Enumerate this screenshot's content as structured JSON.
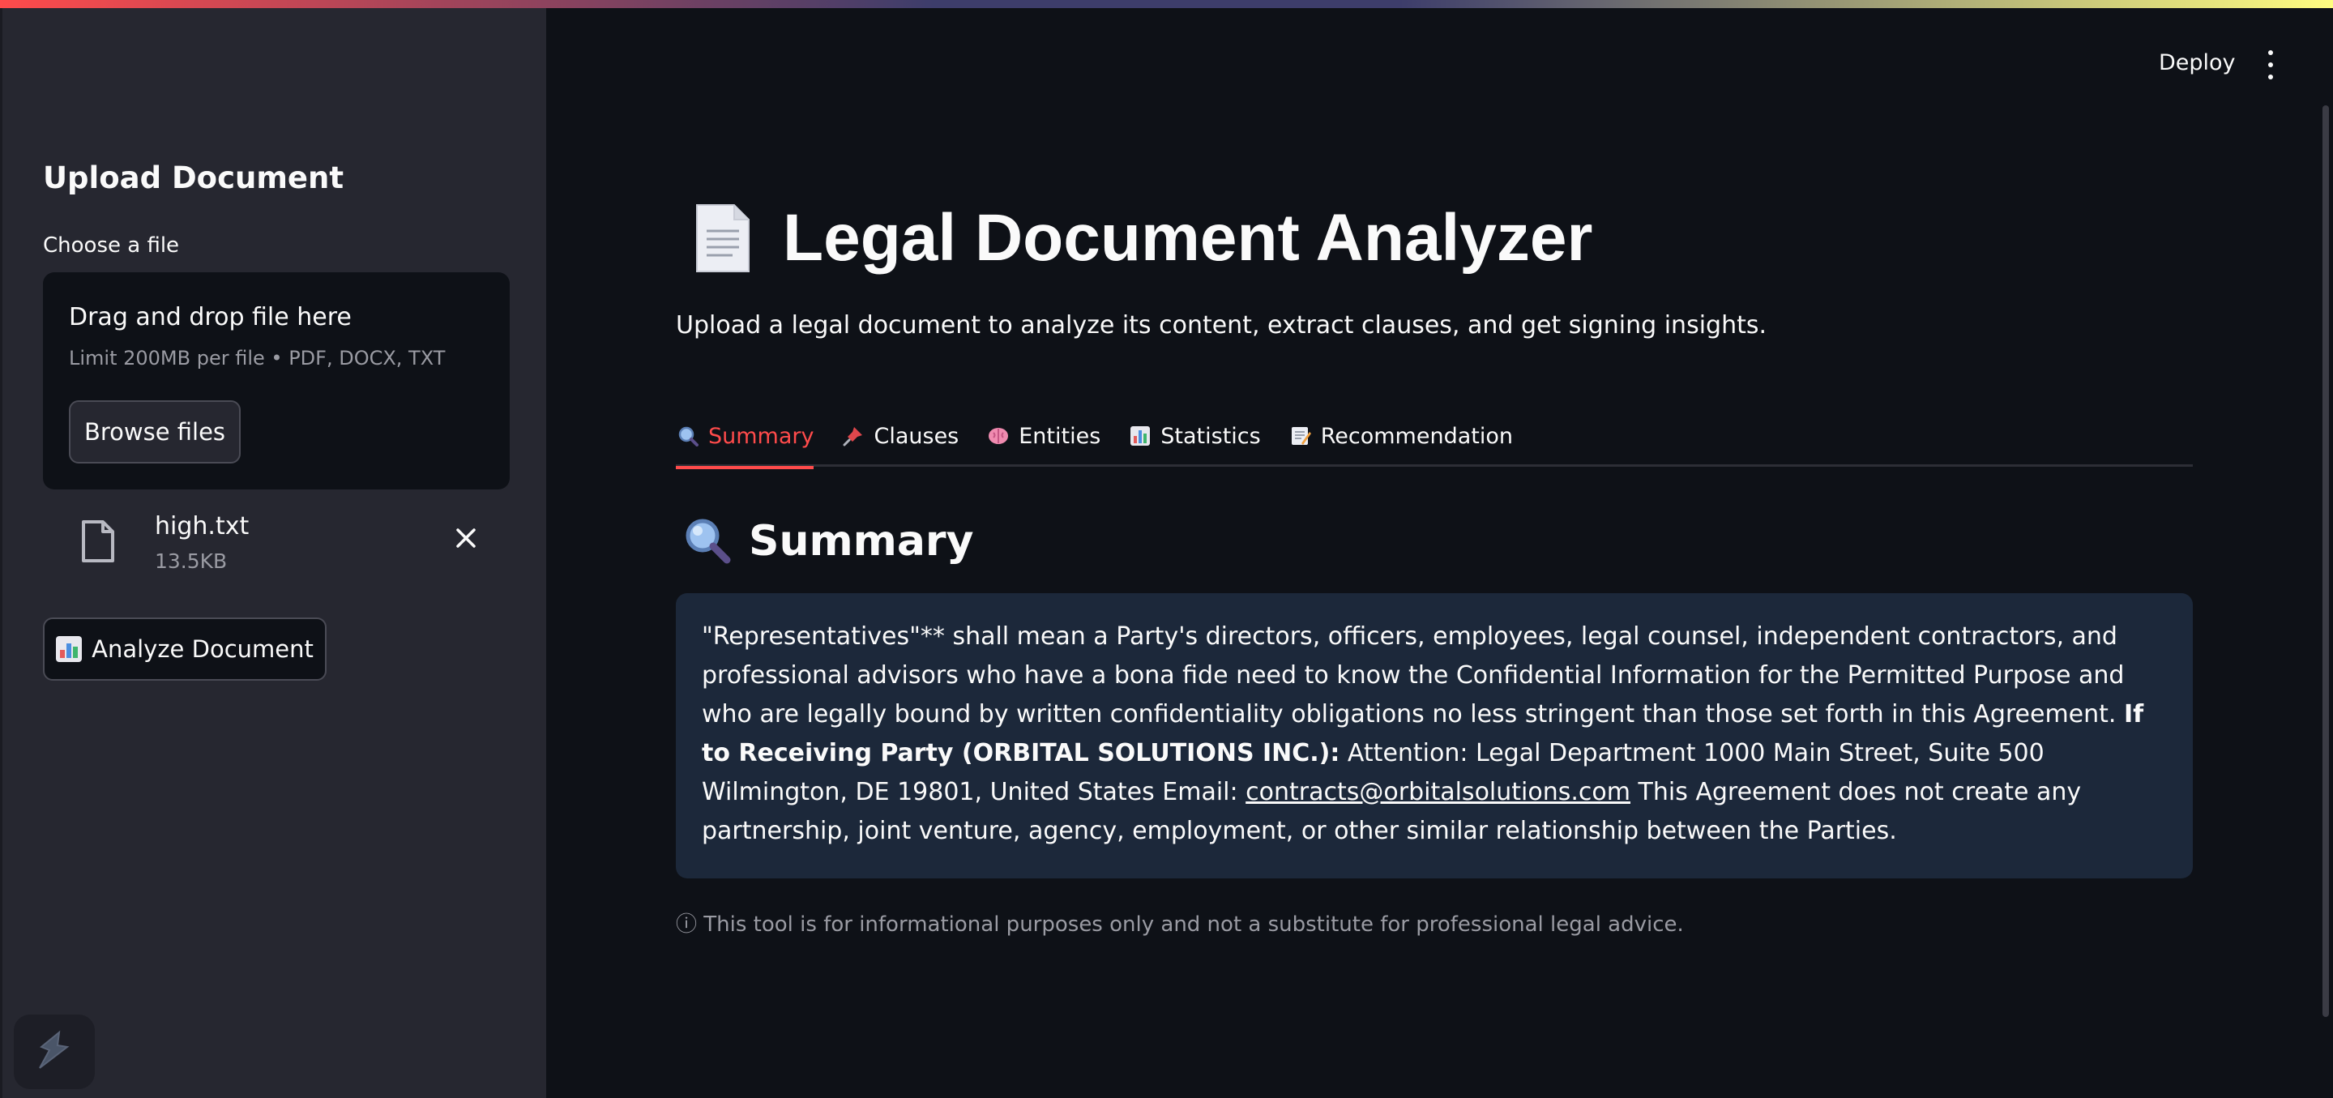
{
  "sidebar": {
    "title": "Upload Document",
    "uploader_label": "Choose a file",
    "dropzone_title": "Drag and drop file here",
    "dropzone_limit": "Limit 200MB per file • PDF, DOCX, TXT",
    "browse_label": "Browse files",
    "file": {
      "name": "high.txt",
      "size": "13.5KB"
    },
    "analyze_label": "Analyze Document"
  },
  "header": {
    "deploy_label": "Deploy"
  },
  "main": {
    "title": "Legal Document Analyzer",
    "subtitle": "Upload a legal document to analyze its content, extract clauses, and get signing insights.",
    "tabs": [
      {
        "label": "Summary",
        "icon": "magnifier-icon"
      },
      {
        "label": "Clauses",
        "icon": "pushpin-icon"
      },
      {
        "label": "Entities",
        "icon": "brain-icon"
      },
      {
        "label": "Statistics",
        "icon": "bar-chart-icon"
      },
      {
        "label": "Recommendation",
        "icon": "memo-icon"
      }
    ],
    "active_tab": "Summary",
    "section_title": "Summary",
    "summary": {
      "part1": "\"Representatives\"** shall mean a Party's directors, officers, employees, legal counsel, independent contractors, and professional advisors who have a bona fide need to know the Confidential Information for the Permitted Purpose and who are legally bound by written confidentiality obligations no less stringent than those set forth in this Agreement. ",
      "bold": "If to Receiving Party (ORBITAL SOLUTIONS INC.):",
      "part2": " Attention: Legal Department 1000 Main Street, Suite 500 Wilmington, DE 19801, United States Email: ",
      "email": "contracts@orbitalsolutions.com",
      "part3": " This Agreement does not create any partnership, joint venture, agency, employment, or other similar relationship between the Parties."
    },
    "disclaimer": "ⓘ This tool is for informational purposes only and not a substitute for professional legal advice."
  },
  "colors": {
    "accent": "#ff4b4b",
    "sidebar_bg": "#262730",
    "main_bg": "#0e1117",
    "summary_bg": "#1c283a"
  }
}
